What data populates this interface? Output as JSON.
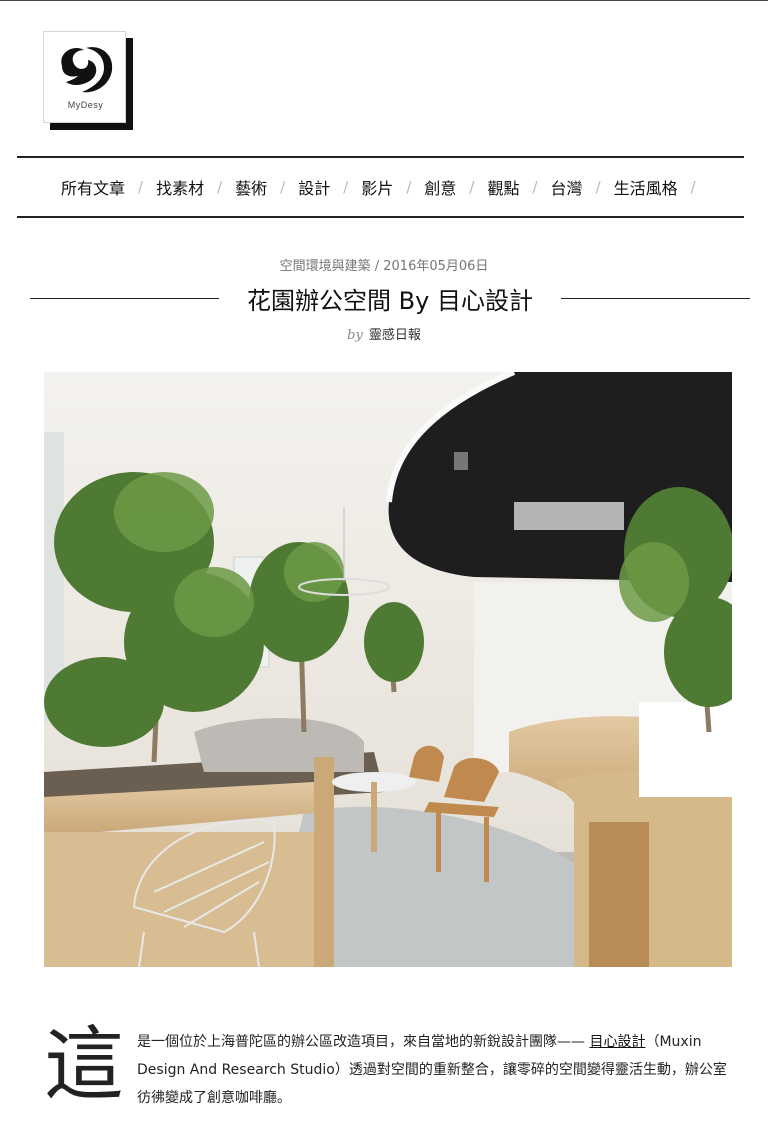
{
  "site": {
    "logo_text": "MyDesy",
    "logo_icon": "mydesy-swirl-logo"
  },
  "nav": {
    "items": [
      {
        "label": "所有文章"
      },
      {
        "label": "找素材"
      },
      {
        "label": "藝術"
      },
      {
        "label": "設計"
      },
      {
        "label": "影片"
      },
      {
        "label": "創意"
      },
      {
        "label": "觀點"
      },
      {
        "label": "台灣"
      },
      {
        "label": "生活風格"
      }
    ],
    "separator": "/"
  },
  "article": {
    "category": "空間環境與建築",
    "meta_separator": " / ",
    "date": "2016年05月06日",
    "title": "花園辦公空間 By 目心設計",
    "by_label": "by",
    "author": "靈感日報",
    "hero_alt": "office interior with trees, curved wooden desks and chairs",
    "dropcap": "這",
    "intro_part1": "是一個位於上海普陀區的辦公區改造項目，來自當地的新銳設計團隊—— ",
    "intro_link": "目心設計",
    "intro_part2": "（Muxin Design And Research Studio）透過對空間的重新整合，讓零碎的空間變得靈活生動，辦公室彷彿變成了創意咖啡廳。"
  },
  "colors": {
    "accent": "#222222",
    "meta": "#777777"
  }
}
